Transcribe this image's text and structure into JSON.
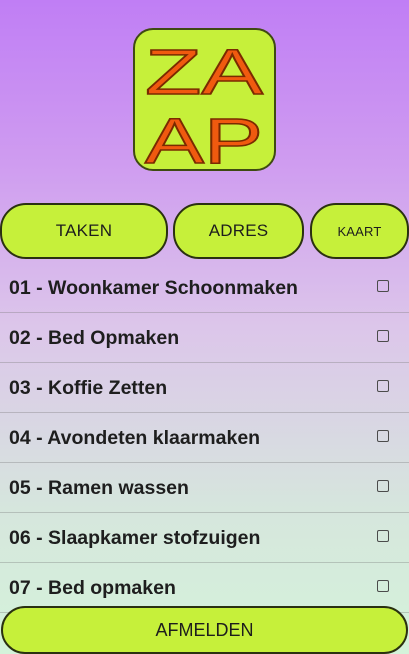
{
  "logo": {
    "line1": "ZA",
    "line2": "AP",
    "bg_color": "#c6f03a",
    "text_color": "#f05a0f"
  },
  "tabs": [
    {
      "label": "TAKEN"
    },
    {
      "label": "ADRES"
    },
    {
      "label": "KAART"
    }
  ],
  "tasks": [
    {
      "label": "01 - Woonkamer Schoonmaken",
      "checked": false
    },
    {
      "label": "02 - Bed Opmaken",
      "checked": false
    },
    {
      "label": "03 - Koffie Zetten",
      "checked": false
    },
    {
      "label": "04 - Avondeten klaarmaken",
      "checked": false
    },
    {
      "label": "05 - Ramen wassen",
      "checked": false
    },
    {
      "label": "06 - Slaapkamer stofzuigen",
      "checked": false
    },
    {
      "label": "07 - Bed opmaken",
      "checked": false
    }
  ],
  "footer": {
    "logout_label": "AFMELDEN"
  }
}
